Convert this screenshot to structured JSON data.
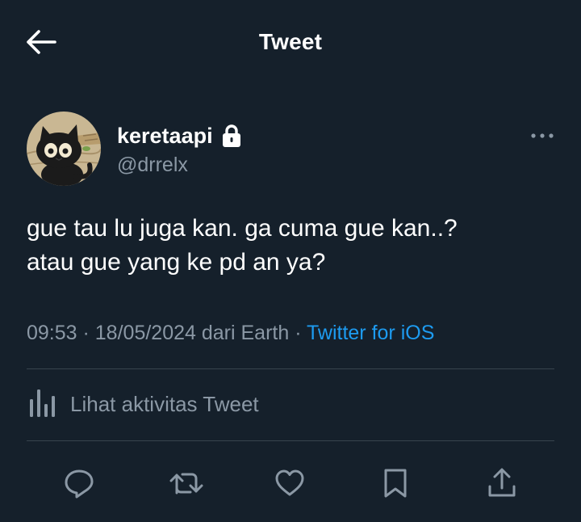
{
  "header": {
    "title": "Tweet",
    "back_icon": "arrow-left-icon"
  },
  "author": {
    "display_name": "keretaapi",
    "handle": "@drrelx",
    "avatar_icon": "black-cat-avatar",
    "protected_icon": "lock-icon",
    "more_icon": "more-horizontal-icon"
  },
  "tweet": {
    "lines": [
      "gue tau lu juga kan. ga cuma gue kan..?",
      "atau gue yang ke pd an ya?"
    ],
    "time": "09:53",
    "separator": " · ",
    "date": "18/05/2024",
    "location_text": " dari Earth",
    "source": "Twitter for iOS"
  },
  "analytics": {
    "label": "Lihat aktivitas Tweet",
    "icon": "analytics-bars-icon"
  },
  "actions": [
    {
      "name": "reply",
      "icon": "reply-icon"
    },
    {
      "name": "retweet",
      "icon": "retweet-icon"
    },
    {
      "name": "like",
      "icon": "heart-icon"
    },
    {
      "name": "bookmark",
      "icon": "bookmark-icon"
    },
    {
      "name": "share",
      "icon": "share-icon"
    }
  ],
  "colors": {
    "background": "#15202b",
    "text_primary": "#ffffff",
    "text_secondary": "#8b98a5",
    "accent": "#1d9bf0",
    "divider": "#38444d"
  }
}
